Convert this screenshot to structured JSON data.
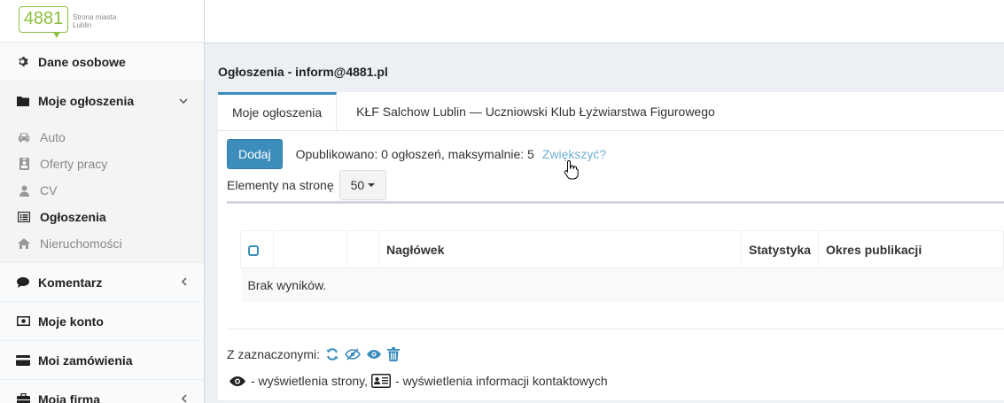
{
  "logo": {
    "number": "4881",
    "line1": "Strona miasta",
    "line2": "Lublin"
  },
  "sidebar": {
    "items": [
      {
        "label": "Dane osobowe",
        "icon": "gear-icon"
      },
      {
        "label": "Moje ogłoszenia",
        "icon": "folder-icon"
      },
      {
        "label": "Komentarz",
        "icon": "comment-icon"
      },
      {
        "label": "Moje konto",
        "icon": "money-icon"
      },
      {
        "label": "Moi zamówienia",
        "icon": "credit-card-icon"
      },
      {
        "label": "Moja firma",
        "icon": "briefcase-icon"
      }
    ],
    "submenu": [
      {
        "label": "Auto",
        "icon": "car-icon"
      },
      {
        "label": "Oferty pracy",
        "icon": "id-badge-icon"
      },
      {
        "label": "CV",
        "icon": "user-icon"
      },
      {
        "label": "Ogłoszenia",
        "icon": "list-alt-icon"
      },
      {
        "label": "Nieruchomości",
        "icon": "home-icon"
      }
    ]
  },
  "content": {
    "title": "Ogłoszenia - inform@4881.pl",
    "tabs": [
      {
        "label": "Moje ogłoszenia"
      },
      {
        "label": "KŁF Salchow Lublin — Uczniowski Klub Łyżwiarstwa Figurowego"
      }
    ],
    "add_button": "Dodaj",
    "published_text": "Opublikowano: 0 ogłoszeń, maksymalnie: 5",
    "increase_link": "Zwiększyć?",
    "per_page_label": "Elementy na stronę",
    "per_page_value": "50",
    "table": {
      "headers": [
        "",
        "",
        "",
        "Nagłówek",
        "Statystyka",
        "Okres publikacji"
      ],
      "empty_text": "Brak wyników."
    },
    "with_selected": "Z zaznaczonymi:",
    "legend": {
      "views_page": "- wyświetlenia strony,",
      "views_contact": "- wyświetlenia informacji kontaktowych"
    }
  },
  "colors": {
    "accent": "#3c8dbc",
    "link": "#72afd2",
    "logo_green": "#8bbf3c"
  }
}
